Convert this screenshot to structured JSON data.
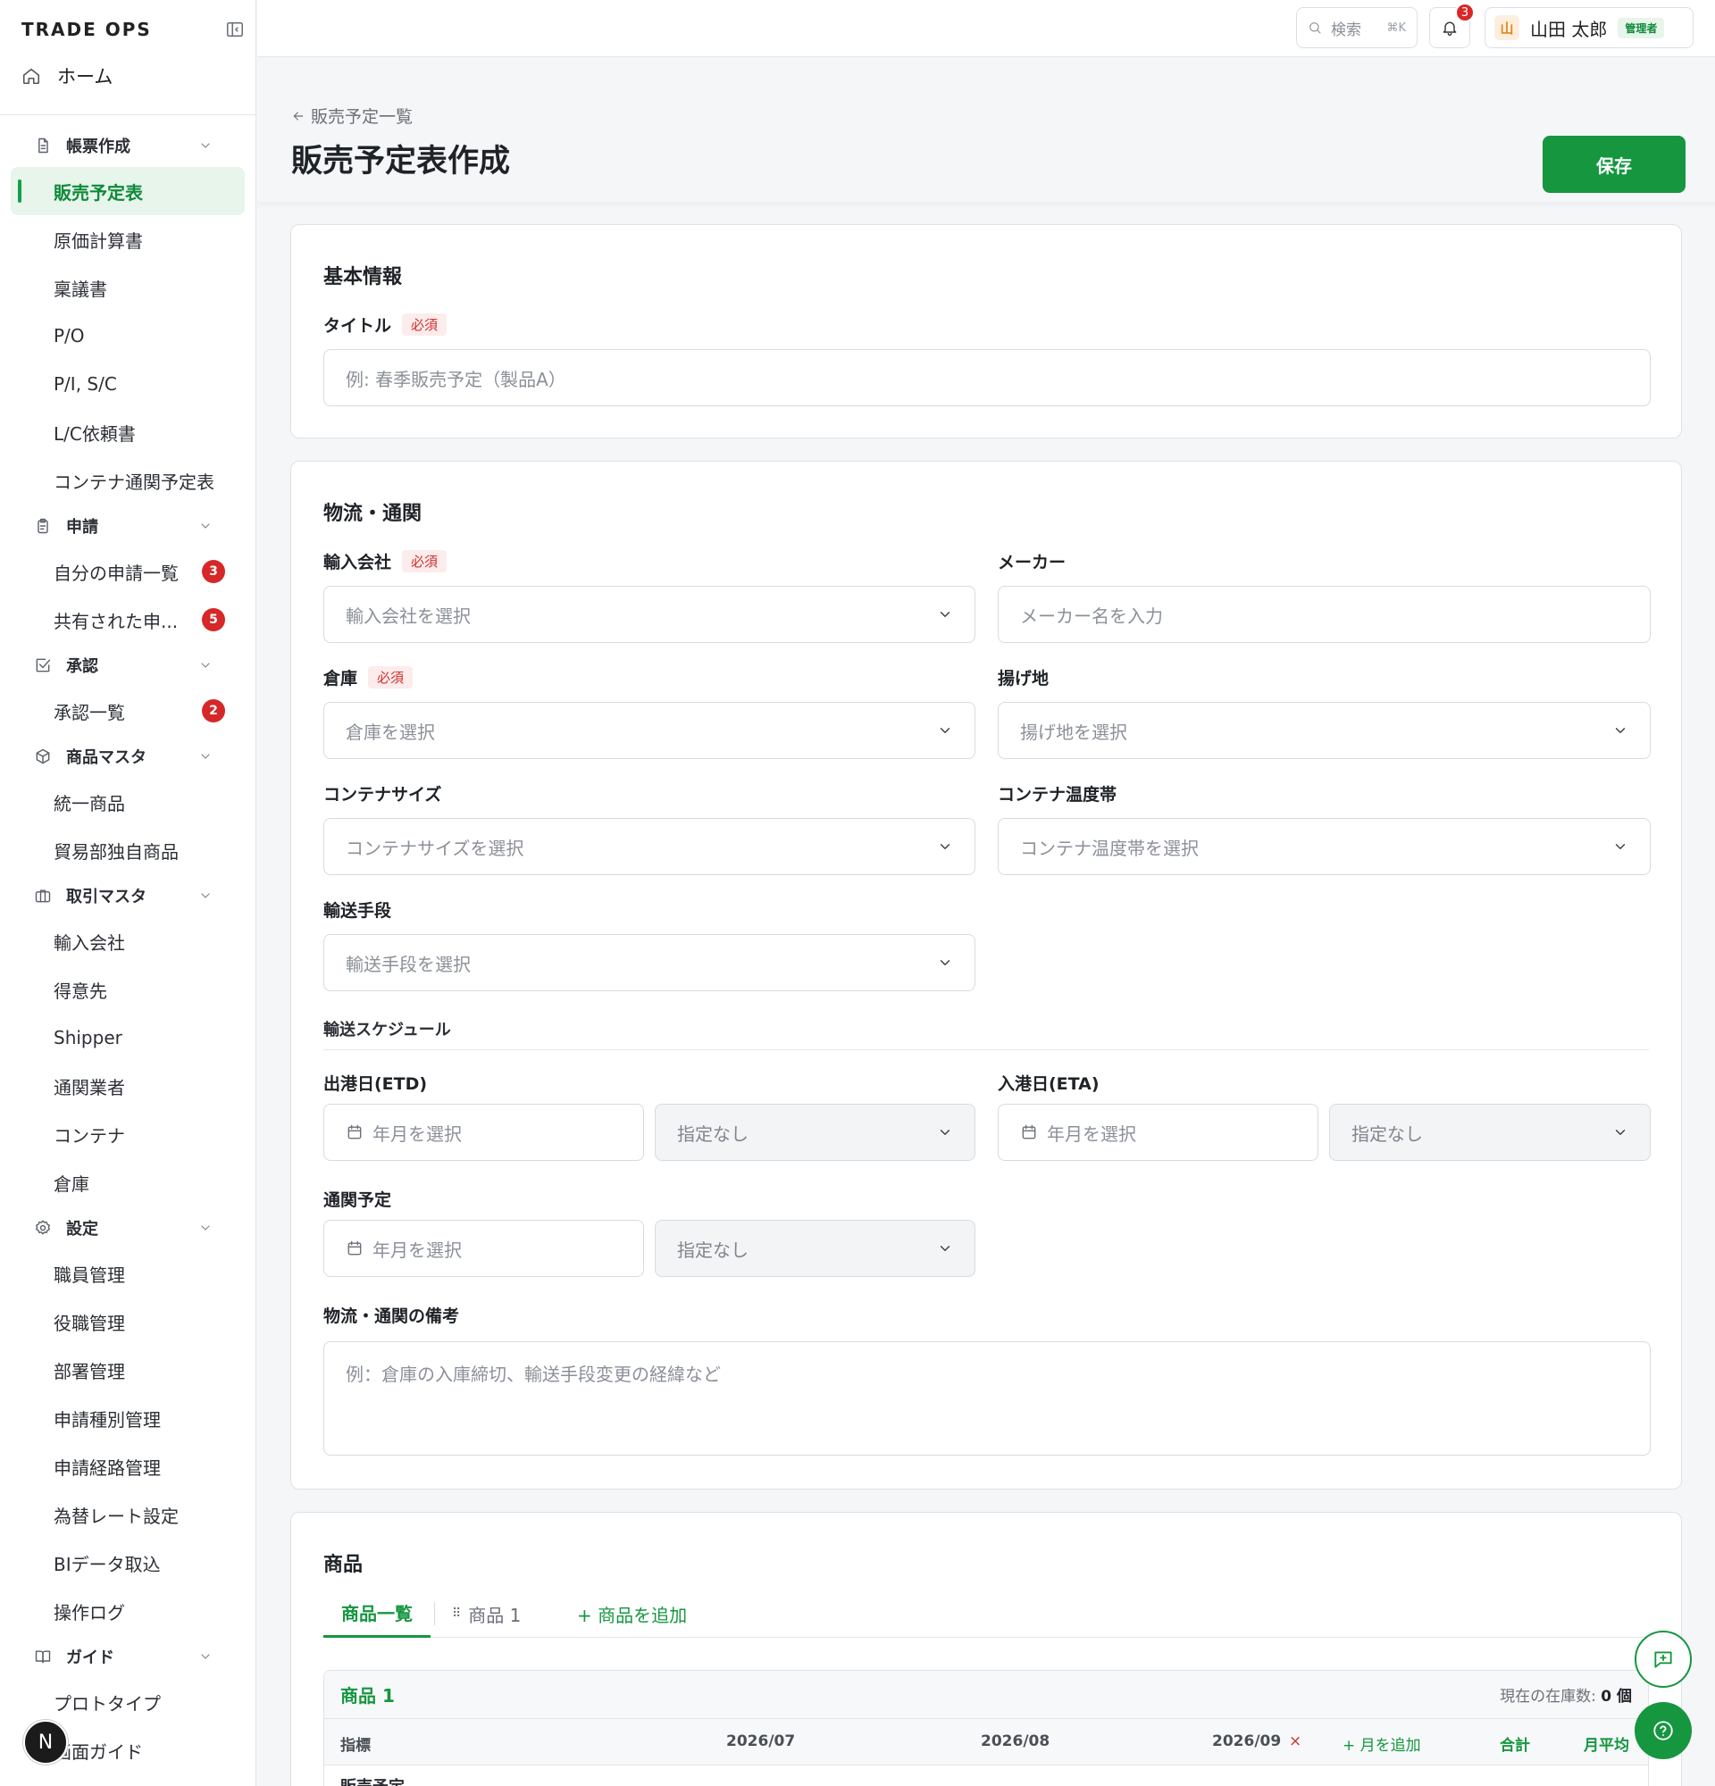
{
  "brand": "TRADE OPS",
  "home_label": "ホーム",
  "sidebar": {
    "sections": [
      {
        "label": "帳票作成",
        "icon": "document-icon",
        "items": [
          {
            "label": "販売予定表",
            "active": true
          },
          {
            "label": "原価計算書"
          },
          {
            "label": "稟議書"
          },
          {
            "label": "P/O"
          },
          {
            "label": "P/I, S/C"
          },
          {
            "label": "L/C依頼書"
          },
          {
            "label": "コンテナ通関予定表"
          }
        ]
      },
      {
        "label": "申請",
        "icon": "clipboard-icon",
        "items": [
          {
            "label": "自分の申請一覧",
            "badge": "3"
          },
          {
            "label": "共有された申...",
            "badge": "5"
          }
        ]
      },
      {
        "label": "承認",
        "icon": "check-square-icon",
        "items": [
          {
            "label": "承認一覧",
            "badge": "2"
          }
        ]
      },
      {
        "label": "商品マスタ",
        "icon": "package-icon",
        "items": [
          {
            "label": "統一商品"
          },
          {
            "label": "貿易部独自商品"
          }
        ]
      },
      {
        "label": "取引マスタ",
        "icon": "briefcase-icon",
        "items": [
          {
            "label": "輸入会社"
          },
          {
            "label": "得意先"
          },
          {
            "label": "Shipper"
          },
          {
            "label": "通関業者"
          },
          {
            "label": "コンテナ"
          },
          {
            "label": "倉庫"
          }
        ]
      },
      {
        "label": "設定",
        "icon": "gear-icon",
        "items": [
          {
            "label": "職員管理"
          },
          {
            "label": "役職管理"
          },
          {
            "label": "部署管理"
          },
          {
            "label": "申請種別管理"
          },
          {
            "label": "申請経路管理"
          },
          {
            "label": "為替レート設定"
          },
          {
            "label": "BIデータ取込"
          },
          {
            "label": "操作ログ"
          }
        ]
      },
      {
        "label": "ガイド",
        "icon": "book-icon",
        "items": [
          {
            "label": "プロトタイプ"
          },
          {
            "label": "画面ガイド"
          }
        ]
      }
    ],
    "avatar_letter": "N"
  },
  "topbar": {
    "search_label": "検索",
    "search_shortcut": "⌘K",
    "notification_count": "3",
    "user_initial": "山",
    "user_name": "山田 太郎",
    "user_role": "管理者"
  },
  "header": {
    "back_label": "販売予定一覧",
    "title": "販売予定表作成",
    "save_label": "保存"
  },
  "basic": {
    "title": "基本情報",
    "title_label": "タイトル",
    "required_label": "必須",
    "title_placeholder": "例: 春季販売予定（製品A）"
  },
  "logistics": {
    "title": "物流・通関",
    "importer_label": "輸入会社",
    "importer_placeholder": "輸入会社を選択",
    "maker_label": "メーカー",
    "maker_placeholder": "メーカー名を入力",
    "warehouse_label": "倉庫",
    "warehouse_placeholder": "倉庫を選択",
    "port_label": "揚げ地",
    "port_placeholder": "揚げ地を選択",
    "container_size_label": "コンテナサイズ",
    "container_size_placeholder": "コンテナサイズを選択",
    "container_temp_label": "コンテナ温度帯",
    "container_temp_placeholder": "コンテナ温度帯を選択",
    "transport_label": "輸送手段",
    "transport_placeholder": "輸送手段を選択",
    "schedule_heading": "輸送スケジュール",
    "etd_label": "出港日(ETD)",
    "eta_label": "入港日(ETA)",
    "customs_label": "通関予定",
    "month_placeholder": "年月を選択",
    "unspecified": "指定なし",
    "notes_label": "物流・通関の備考",
    "notes_placeholder": "例：倉庫の入庫締切、輸送手段変更の経緯など"
  },
  "products": {
    "title": "商品",
    "tab_all": "商品一覧",
    "tab_product": "商品 1",
    "add_product": "+ 商品を追加",
    "table": {
      "product_name": "商品 1",
      "stock_label": "現在の在庫数:",
      "stock_value": "0 個",
      "col_metric": "指標",
      "months": [
        "2026/07",
        "2026/08",
        "2026/09"
      ],
      "remove_symbol": "×",
      "add_month": "+ 月を追加",
      "col_total": "合計",
      "col_avg": "月平均",
      "first_row": "販売予定"
    }
  }
}
